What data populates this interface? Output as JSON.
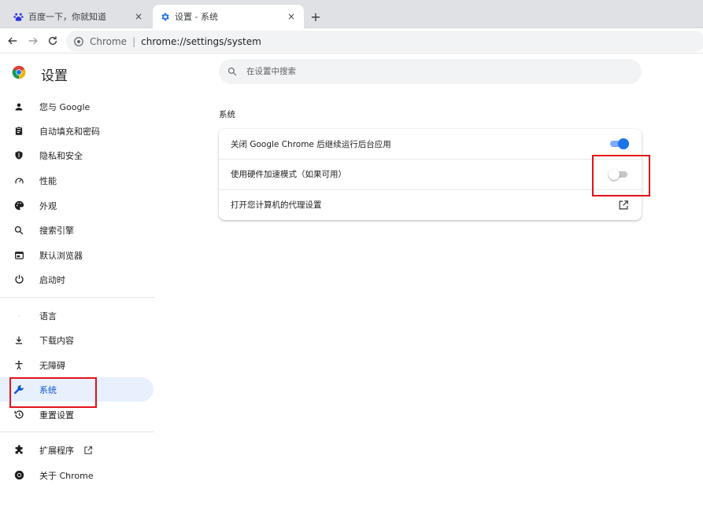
{
  "tabs": [
    {
      "title": "百度一下，你就知道",
      "close": "×"
    },
    {
      "title": "设置 - 系统",
      "close": "×"
    }
  ],
  "new_tab": "+",
  "toolbar": {
    "site_label": "Chrome",
    "separator": "|",
    "url": "chrome://settings/system"
  },
  "app": {
    "title": "设置"
  },
  "search": {
    "placeholder": "在设置中搜索"
  },
  "sidebar": {
    "items": [
      {
        "label": "您与 Google",
        "icon": "person-icon"
      },
      {
        "label": "自动填充和密码",
        "icon": "clipboard-icon"
      },
      {
        "label": "隐私和安全",
        "icon": "shield-icon"
      },
      {
        "label": "性能",
        "icon": "speedometer-icon"
      },
      {
        "label": "外观",
        "icon": "palette-icon"
      },
      {
        "label": "搜索引擎",
        "icon": "search-icon"
      },
      {
        "label": "默认浏览器",
        "icon": "browser-window-icon"
      },
      {
        "label": "启动时",
        "icon": "power-icon"
      },
      {
        "label": "语言",
        "icon": "language-icon"
      },
      {
        "label": "下载内容",
        "icon": "download-icon"
      },
      {
        "label": "无障碍",
        "icon": "accessibility-icon"
      },
      {
        "label": "系统",
        "icon": "wrench-icon"
      },
      {
        "label": "重置设置",
        "icon": "history-icon"
      },
      {
        "label": "扩展程序",
        "icon": "puzzle-icon"
      },
      {
        "label": "关于 Chrome",
        "icon": "chrome-icon"
      }
    ]
  },
  "main": {
    "section_title": "系统",
    "settings": [
      {
        "label": "关闭 Google Chrome 后继续运行后台应用",
        "toggle": true
      },
      {
        "label": "使用硬件加速模式（如果可用）",
        "toggle": false
      },
      {
        "label": "打开您计算机的代理设置",
        "icon": "open-in-new-icon"
      }
    ]
  },
  "colors": {
    "accent": "#1a73e8",
    "selected_bg": "#e8f0fe",
    "highlight": "#e3111b"
  }
}
